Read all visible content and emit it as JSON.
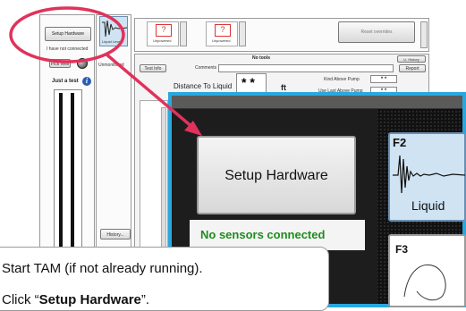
{
  "left_panel": {
    "setup_hardware_label": "Setup Hardware",
    "status_text": "I have not connected",
    "pick_well_label": "Pick Well",
    "just_a_test_label": "Just a test",
    "history_label": "History..."
  },
  "icons": {
    "info": "info-icon",
    "knob": "record-knob-icon"
  },
  "column2": {
    "tab_label": "Liquid Level",
    "side_button": "Unmonitored"
  },
  "top_strip": {
    "box1": {
      "mark": "?",
      "label": "Unpowered"
    },
    "box2": {
      "mark": "?",
      "label": "Unpowered"
    },
    "right_button": "Reset overrides"
  },
  "main": {
    "tab_title": "No tools",
    "history_button": "U. History",
    "test_info_button": "Test Info",
    "comments_label": "Comments",
    "report_button": "Report",
    "distance_label": "Distance To Liquid",
    "distance_value": "* *",
    "distance_unit": "ft",
    "field1_label": "Kind Above Pump",
    "field1_value": "* *",
    "field2_label": "Use Last Above Pump",
    "field2_value": "* *"
  },
  "zoom": {
    "setup_button": "Setup Hardware",
    "status": "No sensors connected",
    "f2_label": "F2",
    "f2_caption": "Liquid",
    "f3_label": "F3"
  },
  "callout": {
    "line1": "Start TAM (if not already running).",
    "line2_prefix": "Click “",
    "line2_bold": "Setup Hardware",
    "line2_suffix": "”."
  },
  "colors": {
    "annotation_red": "#e0325a",
    "zoom_border": "#29a8e0",
    "status_green": "#1e8c1e",
    "tile_blue": "#cfe3f2"
  }
}
